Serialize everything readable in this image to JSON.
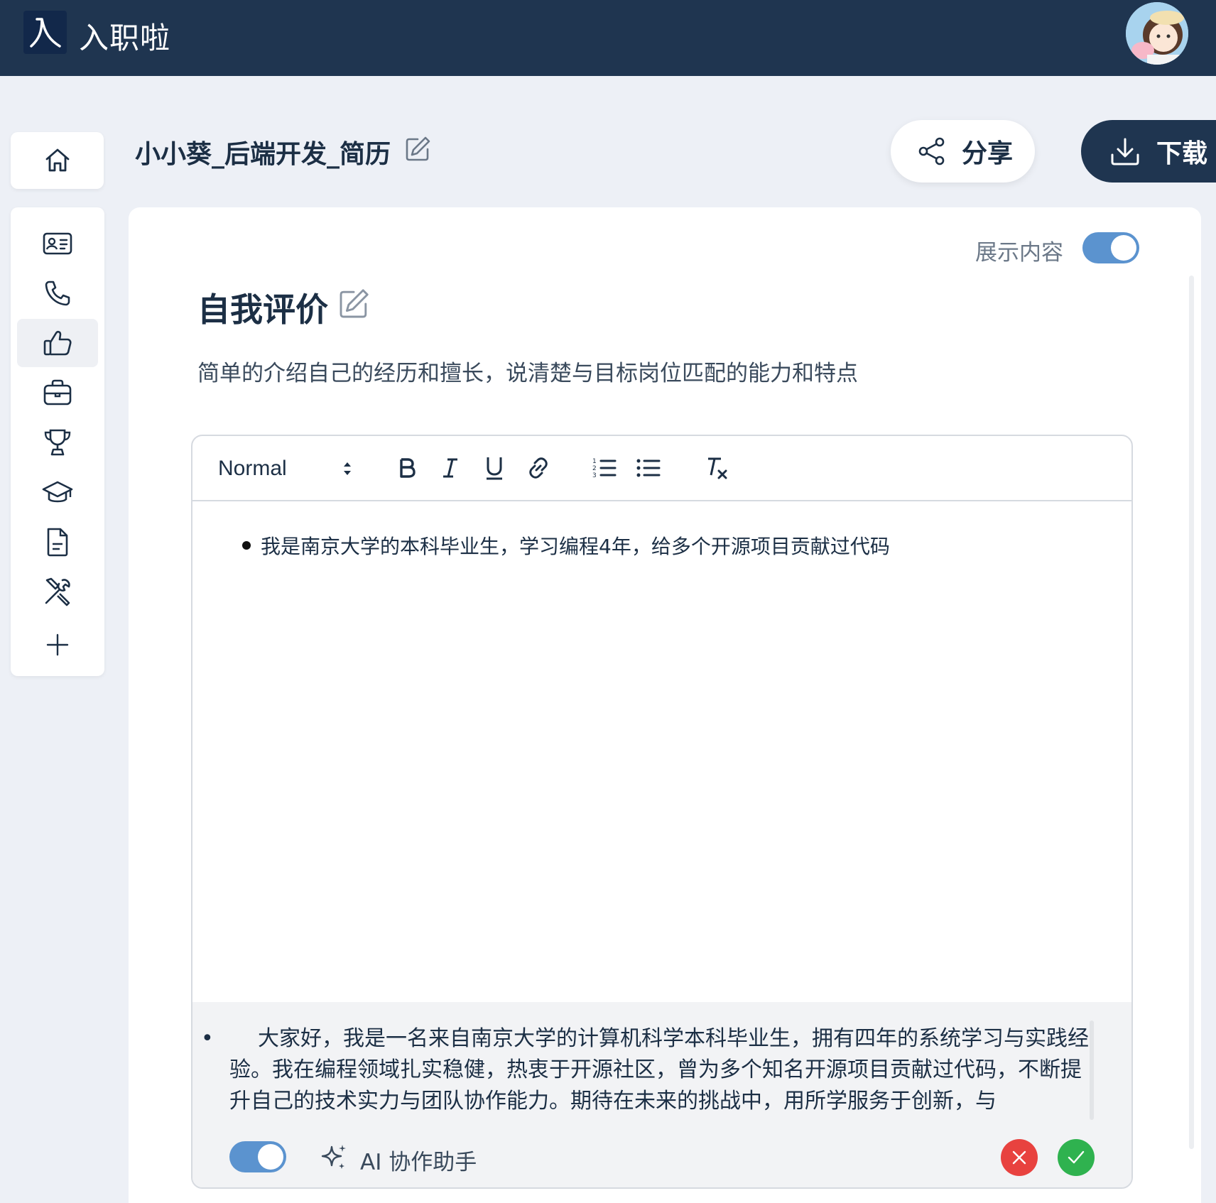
{
  "app": {
    "title": "入职啦",
    "logo_char": "入"
  },
  "header": {
    "document_title": "小小葵_后端开发_简历"
  },
  "actions": {
    "share_label": "分享",
    "download_label": "下载"
  },
  "section": {
    "title": "自我评价",
    "description": "简单的介绍自己的经历和擅长，说清楚与目标岗位匹配的能力和特点",
    "show_content_label": "展示内容",
    "show_content_enabled": true
  },
  "sidebar": {
    "items": [
      {
        "name": "basic-info",
        "icon": "id-card-icon"
      },
      {
        "name": "contact",
        "icon": "phone-icon"
      },
      {
        "name": "self-evaluation",
        "icon": "thumbs-up-icon",
        "active": true
      },
      {
        "name": "work-experience",
        "icon": "briefcase-icon"
      },
      {
        "name": "awards",
        "icon": "trophy-icon"
      },
      {
        "name": "education",
        "icon": "graduation-cap-icon"
      },
      {
        "name": "documents",
        "icon": "file-icon"
      },
      {
        "name": "skills",
        "icon": "tools-icon"
      },
      {
        "name": "add-section",
        "icon": "plus-icon"
      }
    ]
  },
  "editor": {
    "format_value": "Normal",
    "content_bullets": [
      "我是南京大学的本科毕业生，学习编程4年，给多个开源项目贡献过代码"
    ]
  },
  "ai": {
    "assistant_label": "AI 协作助手",
    "enabled": true,
    "suggestion": "大家好，我是一名来自南京大学的计算机科学本科毕业生，拥有四年的系统学习与实践经验。我在编程领域扎实稳健，热衷于开源社区，曾为多个知名开源项目贡献过代码，不断提升自己的技术实力与团队协作能力。期待在未来的挑战中，用所学服务于创新，与"
  },
  "colors": {
    "header_bg": "#1f3550",
    "accent_toggle": "#5b93cf",
    "reject": "#e8423f",
    "accept": "#2fb24f"
  }
}
